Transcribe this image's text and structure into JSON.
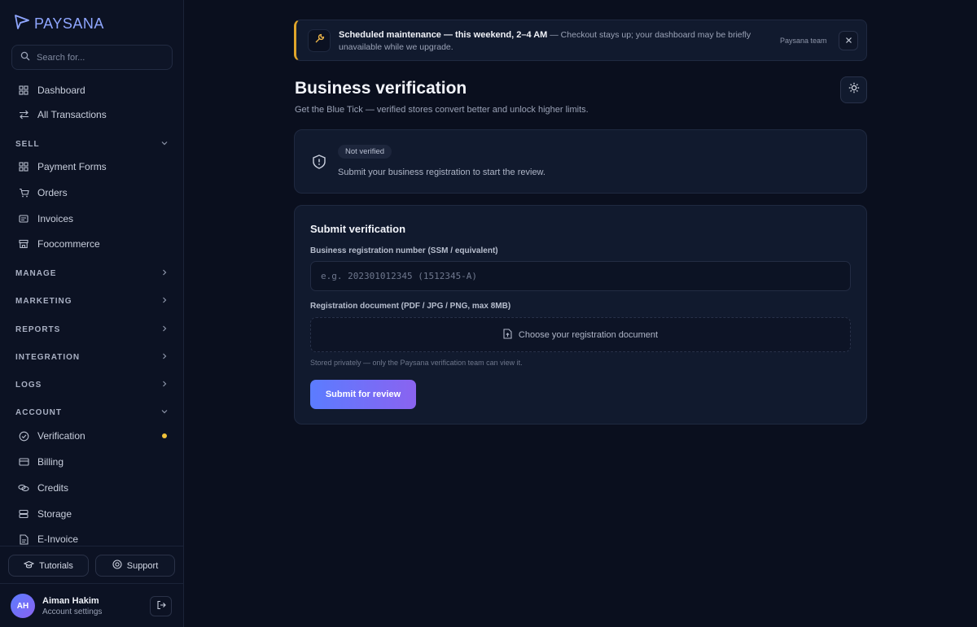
{
  "brand": {
    "name": "PAYSANA"
  },
  "search": {
    "placeholder": "Search for..."
  },
  "sidebar": {
    "top_items": [
      {
        "label": "Dashboard"
      },
      {
        "label": "All Transactions"
      }
    ],
    "sections": {
      "sell": {
        "label": "SELL",
        "items": [
          {
            "label": "Payment Forms"
          },
          {
            "label": "Orders"
          },
          {
            "label": "Invoices"
          },
          {
            "label": "Foocommerce"
          }
        ]
      },
      "manage": {
        "label": "MANAGE"
      },
      "marketing": {
        "label": "MARKETING"
      },
      "reports": {
        "label": "REPORTS"
      },
      "integration": {
        "label": "INTEGRATION"
      },
      "logs": {
        "label": "LOGS"
      },
      "account": {
        "label": "ACCOUNT",
        "items": [
          {
            "label": "Verification"
          },
          {
            "label": "Billing"
          },
          {
            "label": "Credits"
          },
          {
            "label": "Storage"
          },
          {
            "label": "E-Invoice"
          }
        ]
      }
    },
    "tutorials_label": "Tutorials",
    "support_label": "Support"
  },
  "user": {
    "initials": "AH",
    "name": "Aiman Hakim",
    "subtitle": "Account settings"
  },
  "banner": {
    "title": "Scheduled maintenance — this weekend, 2–4 AM",
    "message": " — Checkout stays up; your dashboard may be briefly unavailable while we upgrade.",
    "source": "Paysana team"
  },
  "page": {
    "title": "Business verification",
    "subtitle": "Get the Blue Tick — verified stores convert better and unlock higher limits."
  },
  "status": {
    "badge": "Not verified",
    "text": "Submit your business registration to start the review."
  },
  "form": {
    "title": "Submit verification",
    "reg_label": "Business registration number (SSM / equivalent)",
    "reg_placeholder": "e.g. 202301012345 (1512345-A)",
    "doc_label": "Registration document (PDF / JPG / PNG, max 8MB)",
    "upload_label": "Choose your registration document",
    "hint": "Stored privately — only the Paysana verification team can view it.",
    "submit_label": "Submit for review"
  },
  "colors": {
    "accent": "#5b7cff",
    "accent_end": "#8a63f0",
    "warning": "#e0a52a",
    "dot": "#f2c23a"
  }
}
